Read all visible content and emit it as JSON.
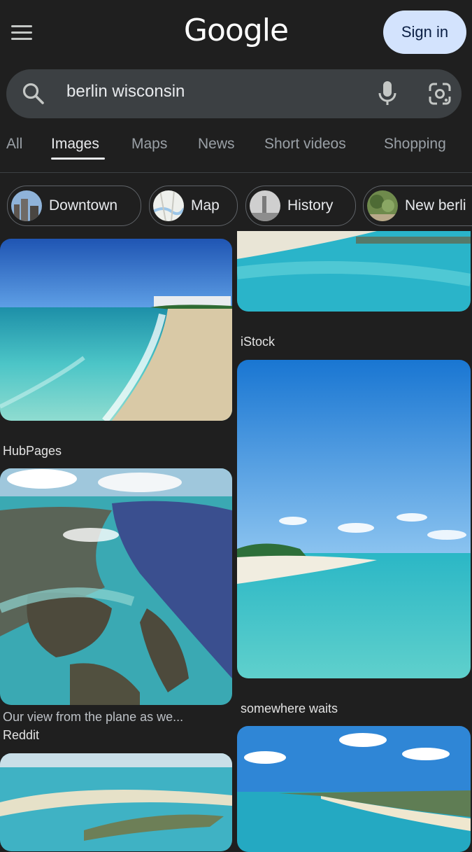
{
  "header": {
    "logo": "Google",
    "signin_label": "Sign in"
  },
  "search": {
    "query": "berlin wisconsin"
  },
  "tabs": [
    "All",
    "Images",
    "Maps",
    "News",
    "Short videos",
    "Shopping"
  ],
  "active_tab": "Images",
  "chips": [
    "Downtown",
    "Map",
    "History",
    "New berli"
  ],
  "results": {
    "r1": {
      "source": "HubPages"
    },
    "r2": {
      "source": "iStock"
    },
    "r3": {
      "caption": "Our view from the plane as we...",
      "source": "Reddit"
    },
    "r4": {
      "source": "somewhere waits"
    }
  },
  "colors": {
    "background": "#1f1f1f",
    "signin_bg": "#d3e3fd",
    "searchbar_bg": "#3c4043"
  }
}
